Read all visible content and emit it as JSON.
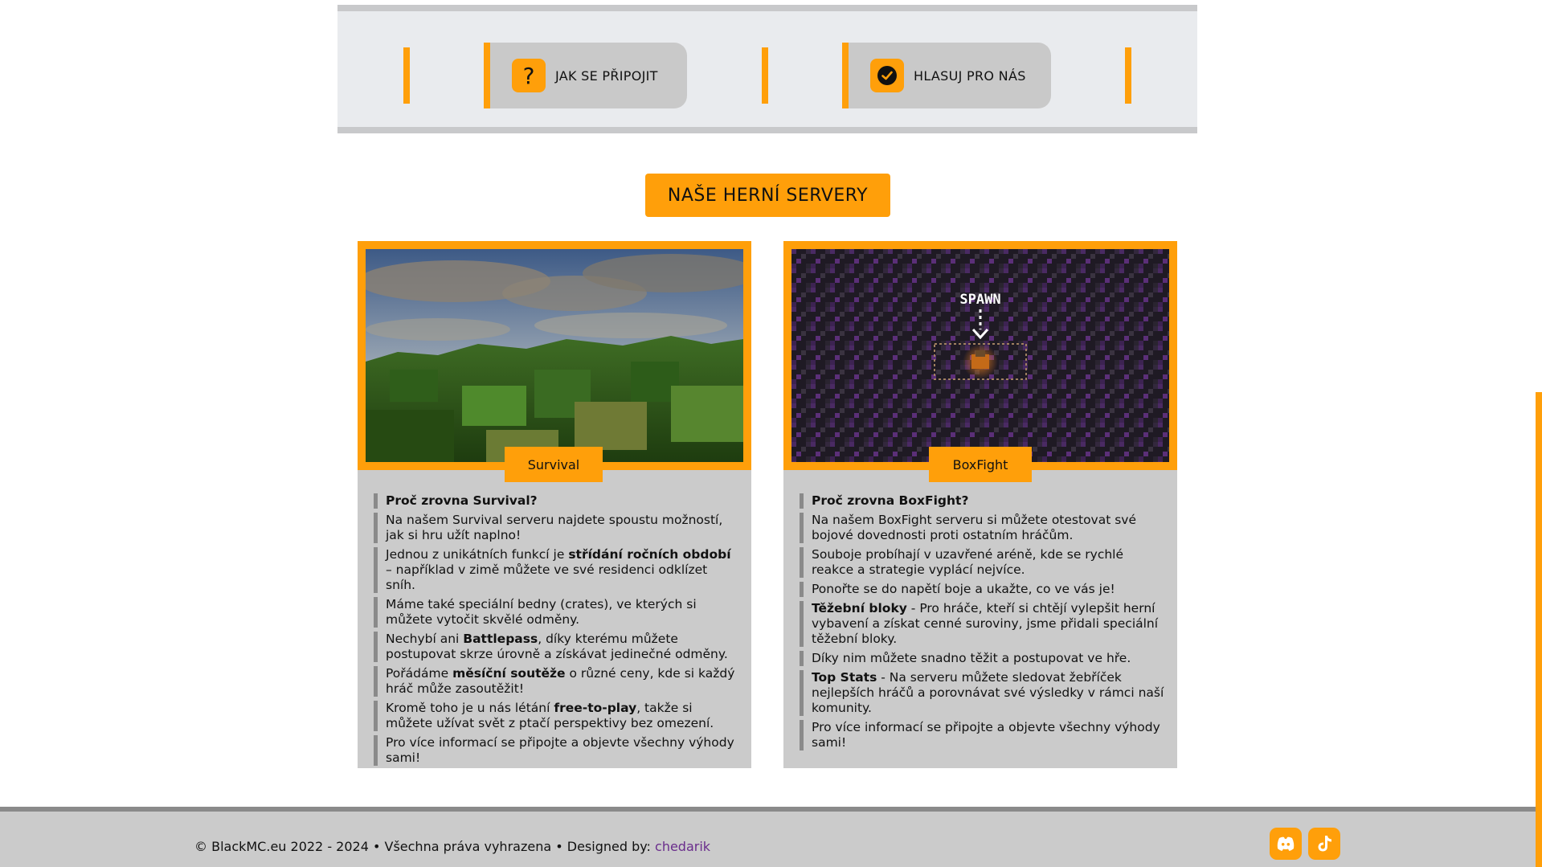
{
  "nav": {
    "how_to_connect": "JAK SE PŘIPOJIT",
    "vote": "HLASUJ PRO NÁS"
  },
  "section_title": "NAŠE HERNÍ SERVERY",
  "servers": [
    {
      "name": "Survival",
      "lead": "Proč zrovna Survival?",
      "items": [
        {
          "t1": "Na našem Survival serveru najdete spoustu možností, jak si hru užít naplno!"
        },
        {
          "t1": "Jednou z unikátních funkcí je ",
          "b": "střídání ročních období",
          "t2": " – například v zimě můžete ve své residenci odklízet sníh."
        },
        {
          "t1": "Máme také speciální bedny (crates), ve kterých si můžete vytočit skvělé odměny."
        },
        {
          "t1": "Nechybí ani ",
          "b": "Battlepass",
          "t2": ", díky kterému můžete postupovat skrze úrovně a získávat jedinečné odměny."
        },
        {
          "t1": "Pořádáme ",
          "b": "měsíční soutěže",
          "t2": " o různé ceny, kde si každý hráč může zasoutěžit!"
        },
        {
          "t1": "Kromě toho je u nás létání ",
          "b": "free-to-play",
          "t2": ", takže si můžete užívat svět z ptačí perspektivy bez omezení."
        },
        {
          "t1": "Pro více informací se připojte a objevte všechny výhody sami!"
        }
      ]
    },
    {
      "name": "BoxFight",
      "lead": "Proč zrovna BoxFight?",
      "image_text": "SPAWN",
      "items": [
        {
          "t1": "Na našem BoxFight serveru si můžete otestovat své bojové dovednosti proti ostatním hráčům."
        },
        {
          "t1": "Souboje probíhají v uzavřené aréně, kde se rychlé reakce a strategie vyplácí nejvíce."
        },
        {
          "t1": "Ponořte se do napětí boje a ukažte, co ve vás je!"
        },
        {
          "t1": "",
          "b": "Těžební bloky",
          "t2": " - Pro hráče, kteří si chtějí vylepšit herní vybavení a získat cenné suroviny, jsme přidali speciální těžební bloky."
        },
        {
          "t1": "Díky nim můžete snadno těžit a postupovat ve hře."
        },
        {
          "t1": "",
          "b": "Top Stats",
          "t2": " - Na serveru můžete sledovat žebříček nejlepších hráčů a porovnávat své výsledky v rámci naší komunity."
        },
        {
          "t1": "Pro více informací se připojte a objevte všechny výhody sami!"
        }
      ]
    }
  ],
  "footer": {
    "copyright": "© BlackMC.eu 2022 - 2024 • Všechna práva vyhrazena • Designed by: ",
    "designer": "chedarik",
    "social": [
      "discord-icon",
      "tiktok-icon"
    ]
  },
  "colors": {
    "accent": "#ff9f0a",
    "panel": "#cbcbcb",
    "designer_link": "#6a2d8c"
  }
}
